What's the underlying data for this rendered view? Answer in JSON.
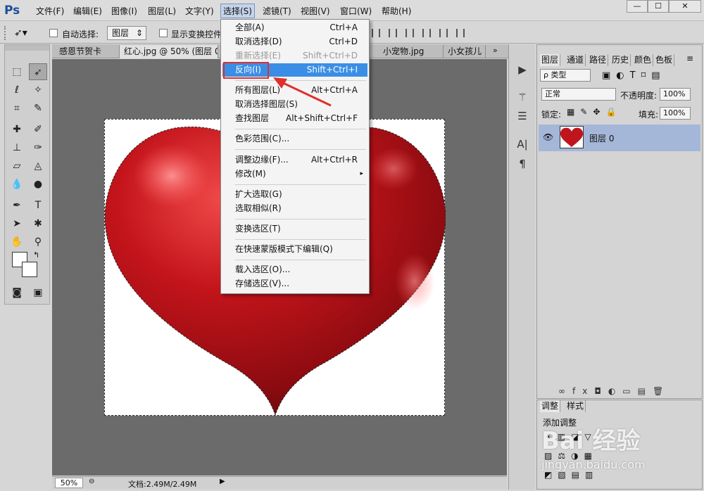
{
  "app": {
    "logo": "Ps"
  },
  "menubar": {
    "items": [
      "文件(F)",
      "编辑(E)",
      "图像(I)",
      "图层(L)",
      "文字(Y)",
      "选择(S)",
      "滤镜(T)",
      "视图(V)",
      "窗口(W)",
      "帮助(H)"
    ],
    "active_index": 5,
    "window_controls": [
      "—",
      "☐",
      "✕"
    ]
  },
  "options_bar": {
    "auto_select_label": "自动选择:",
    "auto_select_value": "图层",
    "show_transform_label": "显示变换控件"
  },
  "tabs": [
    "感恩节贺卡",
    "红心.jpg @ 50% (图层 0",
    "小宠物.jpg",
    "小女孩儿"
  ],
  "active_tab": 1,
  "select_menu": {
    "items": [
      {
        "label": "全部(A)",
        "shortcut": "Ctrl+A"
      },
      {
        "label": "取消选择(D)",
        "shortcut": "Ctrl+D"
      },
      {
        "label": "重新选择(E)",
        "shortcut": "Shift+Ctrl+D",
        "disabled": true
      },
      {
        "label": "反向(I)",
        "shortcut": "Shift+Ctrl+I",
        "highlighted": true
      },
      {
        "label": "所有图层(L)",
        "shortcut": "Alt+Ctrl+A"
      },
      {
        "label": "取消选择图层(S)",
        "shortcut": ""
      },
      {
        "label": "查找图层",
        "shortcut": "Alt+Shift+Ctrl+F"
      },
      {
        "label": "色彩范围(C)...",
        "shortcut": ""
      },
      {
        "label": "调整边缘(F)...",
        "shortcut": "Alt+Ctrl+R"
      },
      {
        "label": "修改(M)",
        "shortcut": "▸"
      },
      {
        "label": "扩大选取(G)",
        "shortcut": ""
      },
      {
        "label": "选取相似(R)",
        "shortcut": ""
      },
      {
        "label": "变换选区(T)",
        "shortcut": ""
      },
      {
        "label": "在快速蒙版模式下编辑(Q)",
        "shortcut": ""
      },
      {
        "label": "载入选区(O)...",
        "shortcut": ""
      },
      {
        "label": "存储选区(V)...",
        "shortcut": ""
      }
    ]
  },
  "layers_panel": {
    "tabs": [
      "图层",
      "通道",
      "路径",
      "历史",
      "颜色",
      "色板"
    ],
    "filter_label": "ρ 类型",
    "blend_mode": "正常",
    "opacity_label": "不透明度:",
    "opacity_value": "100%",
    "lock_label": "锁定:",
    "fill_label": "填充:",
    "fill_value": "100%",
    "layer_name": "图层 0"
  },
  "adjust_panel": {
    "tabs": [
      "调整",
      "样式"
    ],
    "title": "添加调整"
  },
  "status_bar": {
    "zoom": "50%",
    "doc_info": "文档:2.49M/2.49M"
  },
  "watermark": {
    "brand": "Bai 经验",
    "url": "jingyan.baidu.com"
  },
  "colors": {
    "heart": "#c0151c",
    "highlight": "#3a8ee6",
    "callout": "#e0302c"
  }
}
